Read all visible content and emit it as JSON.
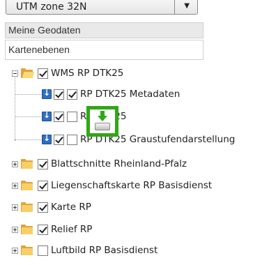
{
  "projection": {
    "value": "UTM zone 32N"
  },
  "accordion": {
    "my_geodata": "Meine Geodaten",
    "map_layers": "Kartenebenen"
  },
  "tree": {
    "wms_group": {
      "label": "WMS RP DTK25",
      "checked": true
    },
    "wms_children": [
      {
        "label": "RP DTK25 Metadaten",
        "checked": true
      },
      {
        "label": "RP DTK25",
        "checked": false
      },
      {
        "label": "RP DTK25 Graustufendarstellung",
        "checked": false
      }
    ],
    "other_groups": [
      {
        "label": "Blattschnitte Rheinland-Pfalz",
        "checked": true
      },
      {
        "label": "Liegenschaftskarte RP Basisdienst",
        "checked": true
      },
      {
        "label": "Karte RP",
        "checked": true
      },
      {
        "label": "Relief RP",
        "checked": true
      },
      {
        "label": "Luftbild RP Basisdienst",
        "checked": false
      }
    ]
  },
  "icons": {
    "expand_collapse": "expand-collapse-icon",
    "folder": "folder-icon",
    "download": "download-icon",
    "drag_feedback": "drag-drop-icon"
  },
  "colors": {
    "folder": "#e3a23c",
    "download": "#2e6fc2",
    "drag_highlight": "#2ea814"
  }
}
